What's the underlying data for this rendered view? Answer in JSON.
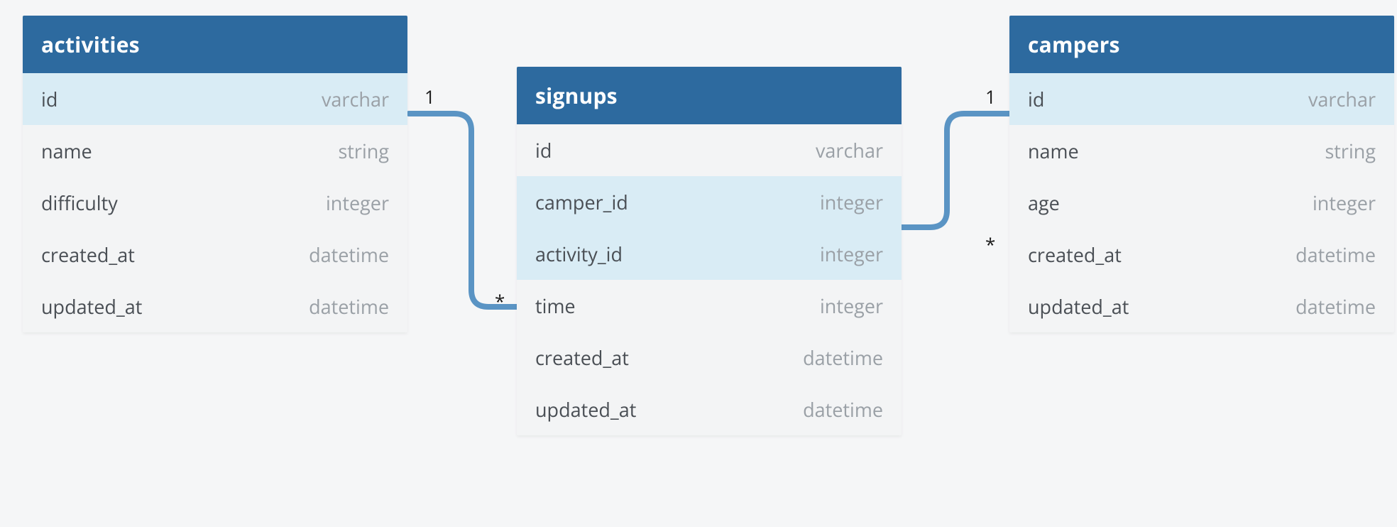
{
  "diagram": {
    "tables": {
      "activities": {
        "title": "activities",
        "columns": [
          {
            "name": "id",
            "type": "varchar",
            "highlight": true
          },
          {
            "name": "name",
            "type": "string",
            "highlight": false
          },
          {
            "name": "difficulty",
            "type": "integer",
            "highlight": false
          },
          {
            "name": "created_at",
            "type": "datetime",
            "highlight": false
          },
          {
            "name": "updated_at",
            "type": "datetime",
            "highlight": false
          }
        ]
      },
      "signups": {
        "title": "signups",
        "columns": [
          {
            "name": "id",
            "type": "varchar",
            "highlight": false
          },
          {
            "name": "camper_id",
            "type": "integer",
            "highlight": true
          },
          {
            "name": "activity_id",
            "type": "integer",
            "highlight": true
          },
          {
            "name": "time",
            "type": "integer",
            "highlight": false
          },
          {
            "name": "created_at",
            "type": "datetime",
            "highlight": false
          },
          {
            "name": "updated_at",
            "type": "datetime",
            "highlight": false
          }
        ]
      },
      "campers": {
        "title": "campers",
        "columns": [
          {
            "name": "id",
            "type": "varchar",
            "highlight": true
          },
          {
            "name": "name",
            "type": "string",
            "highlight": false
          },
          {
            "name": "age",
            "type": "integer",
            "highlight": false
          },
          {
            "name": "created_at",
            "type": "datetime",
            "highlight": false
          },
          {
            "name": "updated_at",
            "type": "datetime",
            "highlight": false
          }
        ]
      }
    },
    "relationships": [
      {
        "from_table": "activities",
        "from_column": "id",
        "from_cardinality": "1",
        "to_table": "signups",
        "to_column": "activity_id",
        "to_cardinality": "*"
      },
      {
        "from_table": "campers",
        "from_column": "id",
        "from_cardinality": "1",
        "to_table": "signups",
        "to_column": "camper_id",
        "to_cardinality": "*"
      }
    ],
    "colors": {
      "header_bg": "#2d6a9f",
      "header_fg": "#ffffff",
      "highlight_bg": "#d9ecf5",
      "canvas_bg": "#f5f6f7",
      "connector": "#5a94c4"
    }
  }
}
